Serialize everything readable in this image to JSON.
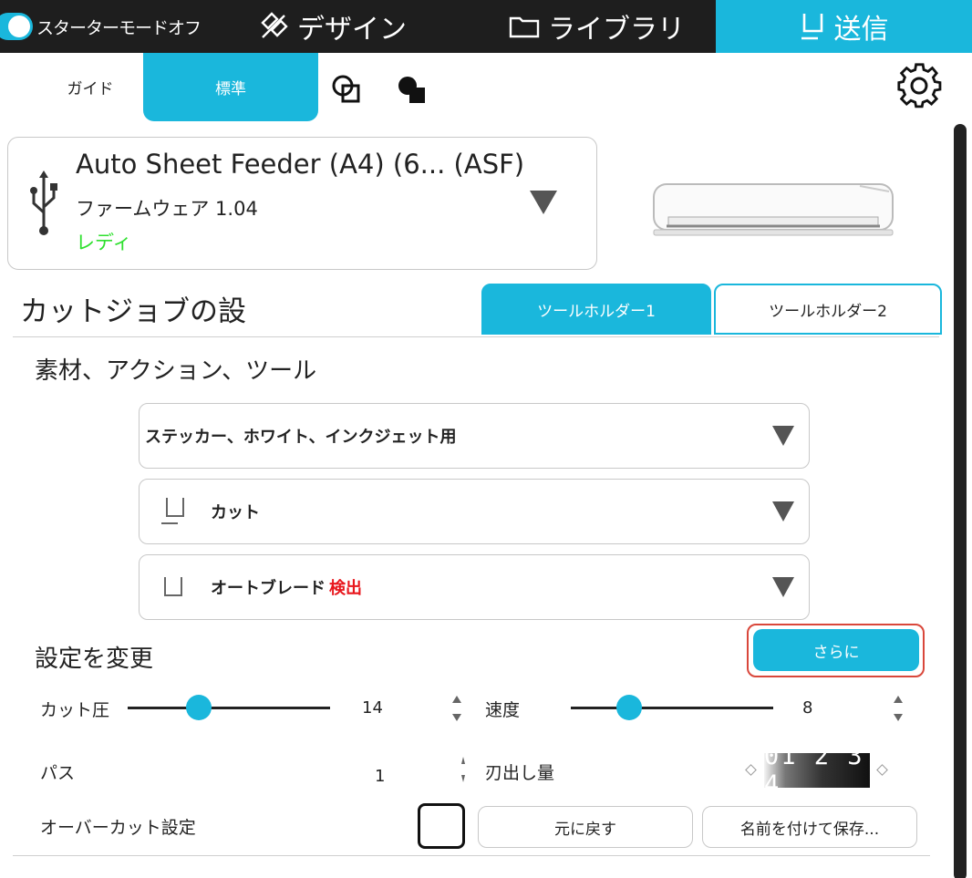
{
  "topbar": {
    "starter_mode_label": "スターターモードオフ",
    "tabs": [
      {
        "label": "デザイン",
        "icon": "design-icon"
      },
      {
        "label": "ライブラリ",
        "icon": "folder-icon"
      },
      {
        "label": "送信",
        "icon": "send-icon",
        "active": true
      }
    ]
  },
  "modebar": {
    "guide_label": "ガイド",
    "standard_label": "標準",
    "standard_active": true
  },
  "device": {
    "name": "Auto Sheet Feeder (A4) (6... (ASF)",
    "firmware": "ファームウェア 1.04",
    "status": "レディ",
    "status_color": "#2ee02e"
  },
  "cutjob": {
    "title": "カットジョブの設",
    "tool_holder_tabs": [
      "ツールホルダー1",
      "ツールホルダー2"
    ],
    "subtitle": "素材、アクション、ツール",
    "material": "ステッカー、ホワイト、インクジェット用",
    "action": "カット",
    "tool": "オートブレード",
    "tool_status": "検出",
    "tool_status_color": "#e8171d"
  },
  "settings": {
    "title": "設定を変更",
    "more_label": "さらに",
    "force_label": "カット圧",
    "force_value": "14",
    "force_level": 0.27,
    "speed_label": "速度",
    "speed_value": "8",
    "speed_level": 0.31,
    "passes_label": "パス",
    "passes_value": "1",
    "blade_depth_label": "刃出し量",
    "blade_depth_digits": "01 2 3 4",
    "overcut_label": "オーバーカット設定",
    "overcut_checked": false,
    "reset_label": "元に戻す",
    "save_as_label": "名前を付けて保存..."
  },
  "colors": {
    "accent": "#1ab7dc",
    "topbar_bg": "#1e1e1e",
    "highlight_outline": "#d9473b"
  }
}
